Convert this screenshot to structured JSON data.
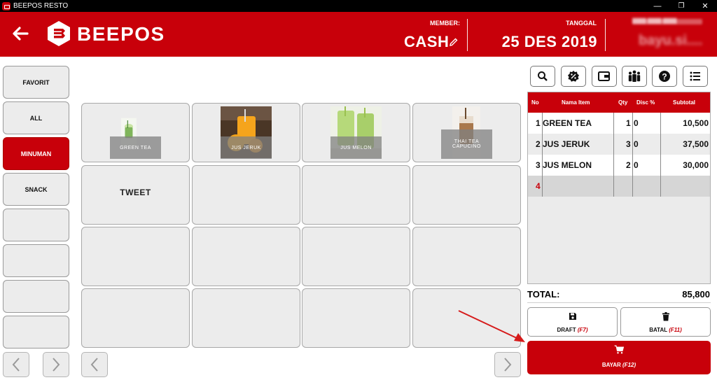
{
  "window": {
    "title": "BEEPOS RESTO",
    "minimize": "—",
    "restore": "❐",
    "close": "✕"
  },
  "header": {
    "brand": "BEEPOS",
    "member_label": "MEMBER:",
    "member_value": "CASH",
    "date_label": "TANGGAL",
    "date_value": "25 DES 2019",
    "user_small": "████ ████ ████",
    "user_name": "bayu.si....",
    "colors": {
      "primary": "#c8000a"
    }
  },
  "categories": [
    {
      "label": "FAVORIT",
      "active": false
    },
    {
      "label": "ALL",
      "active": false
    },
    {
      "label": "MINUMAN",
      "active": true
    },
    {
      "label": "SNACK",
      "active": false
    },
    {
      "label": "",
      "active": false
    },
    {
      "label": "",
      "active": false
    },
    {
      "label": "",
      "active": false
    },
    {
      "label": "",
      "active": false
    }
  ],
  "items": {
    "row1": [
      {
        "name": "GREEN TEA",
        "image": "green-tea"
      },
      {
        "name": "JUS JERUK",
        "image": "orange-juice"
      },
      {
        "name": "JUS MELON",
        "image": "melon-juice"
      },
      {
        "name": "THAI TEA CAPUCINO",
        "image": "thai-tea"
      }
    ],
    "tweet": "TWEET"
  },
  "tools": [
    "search-icon",
    "discount-badge-icon",
    "wallet-icon",
    "customers-icon",
    "help-icon",
    "list-icon"
  ],
  "order": {
    "headers": {
      "no": "No",
      "item": "Nama Item",
      "qty": "Qty",
      "disc": "Disc %",
      "subtotal": "Subtotal"
    },
    "rows": [
      {
        "no": "1",
        "item": "GREEN TEA",
        "qty": "1",
        "disc": "0",
        "subtotal": "10,500"
      },
      {
        "no": "2",
        "item": "JUS JERUK",
        "qty": "3",
        "disc": "0",
        "subtotal": "37,500"
      },
      {
        "no": "3",
        "item": "JUS MELON",
        "qty": "2",
        "disc": "0",
        "subtotal": "30,000"
      },
      {
        "no": "4",
        "item": "",
        "qty": "",
        "disc": "",
        "subtotal": ""
      }
    ],
    "total_label": "TOTAL:",
    "total_value": "85,800"
  },
  "actions": {
    "draft_label": "DRAFT",
    "draft_key": "(F7)",
    "cancel_label": "BATAL",
    "cancel_key": "(F11)",
    "pay_label": "BAYAR",
    "pay_key": "(F12)"
  }
}
